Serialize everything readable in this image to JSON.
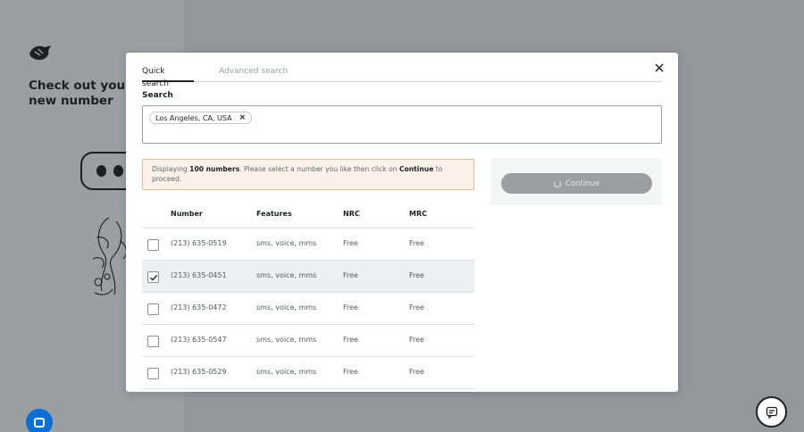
{
  "background": {
    "heading": "Check out your new number",
    "chat_bubble_icon": "chat-bubble-icon",
    "help_icon": "message-icon"
  },
  "modal": {
    "tabs": [
      {
        "label": "Quick search",
        "active": true
      },
      {
        "label": "Advanced search",
        "active": false
      }
    ],
    "close_icon": "close-icon",
    "search": {
      "label": "Search",
      "chip": "Los Angeles, CA, USA",
      "chip_remove": "×"
    },
    "notice": {
      "prefix": "Displaying",
      "count": "100 numbers",
      "middle": ". Please select a number you like then click on",
      "action": "Continue",
      "suffix": "to proceed."
    },
    "table": {
      "headers": [
        "Number",
        "Features",
        "NRC",
        "MRC"
      ],
      "rows": [
        {
          "number": "(213) 635-0519",
          "features": "sms, voice, mms",
          "nrc": "Free",
          "mrc": "Free",
          "checked": false
        },
        {
          "number": "(213) 635-0451",
          "features": "sms, voice, mms",
          "nrc": "Free",
          "mrc": "Free",
          "checked": true
        },
        {
          "number": "(213) 635-0472",
          "features": "sms, voice, mms",
          "nrc": "Free",
          "mrc": "Free",
          "checked": false
        },
        {
          "number": "(213) 635-0547",
          "features": "sms, voice, mms",
          "nrc": "Free",
          "mrc": "Free",
          "checked": false
        },
        {
          "number": "(213) 635-0529",
          "features": "sms, voice, mms",
          "nrc": "Free",
          "mrc": "Free",
          "checked": false
        }
      ]
    },
    "continue_button": {
      "label": "Continue",
      "state": "loading"
    }
  },
  "colors": {
    "overlay": "#93979a",
    "notice_bg": "#fdf1ea",
    "notice_border": "#f0b894",
    "selected_row": "#eeeff0",
    "button_disabled": "#9b9fa2",
    "chat_blue": "#0b6fd4"
  }
}
